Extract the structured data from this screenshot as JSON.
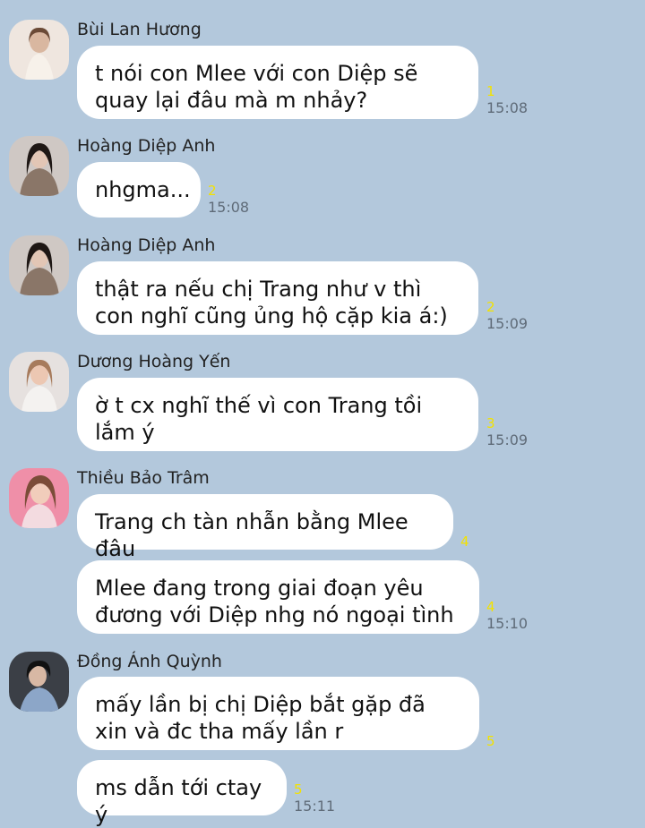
{
  "messages": [
    {
      "sender": "Bùi Lan Hương",
      "text": "t nói con Mlee với con Diệp sẽ quay lại đâu mà m nhảy?",
      "unread": "1",
      "time": "15:08"
    },
    {
      "sender": "Hoàng Diệp Anh",
      "text": "nhgma...",
      "unread": "2",
      "time": "15:08"
    },
    {
      "sender": "Hoàng Diệp Anh",
      "text": "thật ra nếu chị Trang như v thì con nghĩ cũng ủng hộ cặp kia á:)",
      "unread": "2",
      "time": "15:09"
    },
    {
      "sender": "Dương Hoàng Yến",
      "text": "ờ t cx nghĩ thế vì con Trang tồi lắm ý",
      "unread": "3",
      "time": "15:09"
    },
    {
      "sender": "Thiều Bảo Trâm",
      "text": "Trang ch tàn nhẫn bằng Mlee đâu",
      "unread": "4",
      "time": ""
    },
    {
      "text": "Mlee đang trong giai đoạn yêu đương với Diệp nhg nó ngoại tình",
      "unread": "4",
      "time": "15:10"
    },
    {
      "sender": "Đồng Ánh Quỳnh",
      "text": "mấy lần bị chị Diệp bắt gặp đã xin và đc tha mấy lần r",
      "unread": "5",
      "time": ""
    },
    {
      "text": "ms dẫn tới ctay ý",
      "unread": "5",
      "time": "15:11"
    }
  ]
}
